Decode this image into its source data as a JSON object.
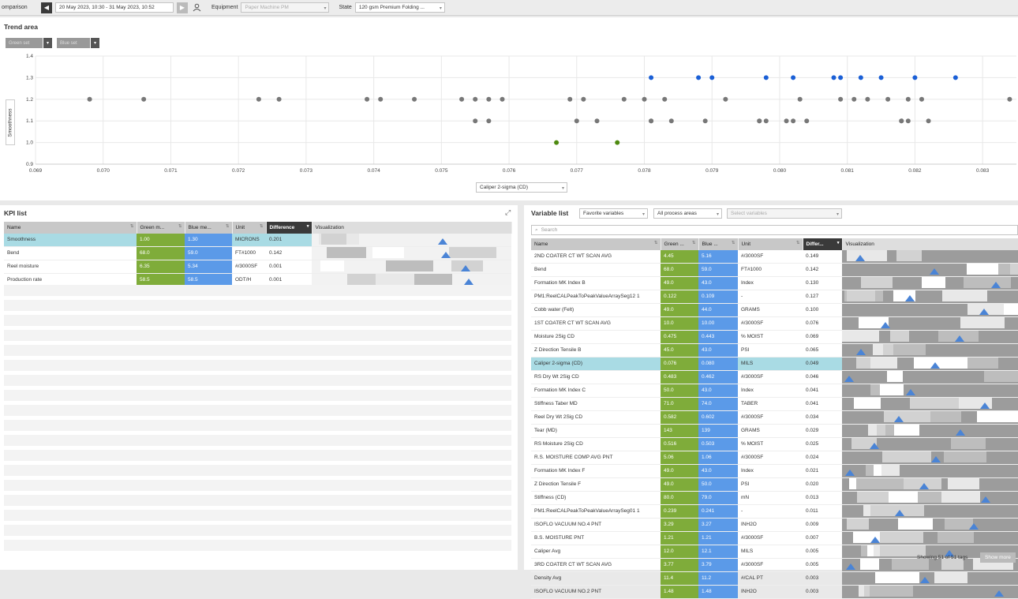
{
  "topbar": {
    "title": "omparison",
    "range": "20 May 2023, 10:30 - 31 May 2023, 10:52",
    "equipment_label": "Equipment",
    "equipment_value": "Paper Machine PM",
    "state_label": "State",
    "state_value": "120 gsm Premium Folding ..."
  },
  "trend": {
    "title": "Trend area",
    "green_set": "Green set",
    "blue_set": "Blue set",
    "y_axis_label": "Smoothness",
    "x_axis_select": "Caliper 2-sigma (CD)"
  },
  "chart_data": {
    "type": "scatter",
    "xlabel": "Caliper 2-sigma (CD)",
    "ylabel": "Smoothness",
    "xlim": [
      0.069,
      0.0835
    ],
    "ylim": [
      0.9,
      1.4
    ],
    "x_ticks": [
      "0.069",
      "0.070",
      "0.071",
      "0.072",
      "0.073",
      "0.074",
      "0.075",
      "0.076",
      "0.077",
      "0.078",
      "0.079",
      "0.080",
      "0.081",
      "0.082",
      "0.083"
    ],
    "y_ticks": [
      "0.9",
      "1.0",
      "1.1",
      "1.2",
      "1.3",
      "1.4"
    ],
    "grid": true,
    "series": [
      {
        "color": "#777777",
        "points": [
          [
            0.0698,
            1.2
          ],
          [
            0.0706,
            1.2
          ],
          [
            0.0723,
            1.2
          ],
          [
            0.0726,
            1.2
          ],
          [
            0.0739,
            1.2
          ],
          [
            0.0741,
            1.2
          ],
          [
            0.0746,
            1.2
          ],
          [
            0.0753,
            1.2
          ],
          [
            0.0755,
            1.2
          ],
          [
            0.0757,
            1.2
          ],
          [
            0.0759,
            1.2
          ],
          [
            0.0769,
            1.2
          ],
          [
            0.0771,
            1.2
          ],
          [
            0.0777,
            1.2
          ],
          [
            0.078,
            1.2
          ],
          [
            0.0783,
            1.2
          ],
          [
            0.0792,
            1.2
          ],
          [
            0.0803,
            1.2
          ],
          [
            0.0809,
            1.2
          ],
          [
            0.0811,
            1.2
          ],
          [
            0.0813,
            1.2
          ],
          [
            0.0816,
            1.2
          ],
          [
            0.0819,
            1.2
          ],
          [
            0.0821,
            1.2
          ],
          [
            0.0834,
            1.2
          ],
          [
            0.0755,
            1.1
          ],
          [
            0.0757,
            1.1
          ],
          [
            0.077,
            1.1
          ],
          [
            0.0773,
            1.1
          ],
          [
            0.0781,
            1.1
          ],
          [
            0.0781,
            1.1
          ],
          [
            0.0784,
            1.1
          ],
          [
            0.0789,
            1.1
          ],
          [
            0.0797,
            1.1
          ],
          [
            0.0797,
            1.1
          ],
          [
            0.0798,
            1.1
          ],
          [
            0.0801,
            1.1
          ],
          [
            0.0802,
            1.1
          ],
          [
            0.0804,
            1.1
          ],
          [
            0.0818,
            1.1
          ],
          [
            0.0818,
            1.1
          ],
          [
            0.0819,
            1.1
          ],
          [
            0.0822,
            1.1
          ]
        ]
      },
      {
        "color": "#1a5fd6",
        "points": [
          [
            0.0781,
            1.3
          ],
          [
            0.0788,
            1.3
          ],
          [
            0.079,
            1.3
          ],
          [
            0.0798,
            1.3
          ],
          [
            0.0802,
            1.3
          ],
          [
            0.0808,
            1.3
          ],
          [
            0.0809,
            1.3
          ],
          [
            0.0812,
            1.3
          ],
          [
            0.0815,
            1.3
          ],
          [
            0.082,
            1.3
          ],
          [
            0.0826,
            1.3
          ]
        ]
      },
      {
        "color": "#4e8a10",
        "points": [
          [
            0.0767,
            1.0
          ],
          [
            0.0776,
            1.0
          ]
        ]
      }
    ]
  },
  "kpi": {
    "title": "KPI list",
    "headers": [
      "Name",
      "Green m...",
      "Blue me...",
      "Unit",
      "Difference",
      "Visualization"
    ],
    "rows": [
      [
        "Smoothness",
        "1.00",
        "1.30",
        "MICRONS",
        "0.201"
      ],
      [
        "Bend",
        "68.0",
        "59.0",
        "FT#1000",
        "0.142"
      ],
      [
        "Reel moisture",
        "6.35",
        "5.34",
        "#/3000SF",
        "0.001"
      ],
      [
        "Production rate",
        "58.5",
        "58.5",
        "ODT/H",
        "0.001"
      ]
    ]
  },
  "vars": {
    "title": "Variable list",
    "favorite": "Favorite variables",
    "areas": "All process areas",
    "select_placeholder": "Select variables",
    "search_placeholder": "Search",
    "headers": [
      "Name",
      "Green ...",
      "Blue ...",
      "Unit",
      "Differ...",
      "Visualization"
    ],
    "rows": [
      [
        "2ND COATER CT WT SCAN AVG",
        "4.45",
        "5.16",
        "#/3000SF",
        "0.149"
      ],
      [
        "Bend",
        "68.0",
        "59.0",
        "FT#1000",
        "0.142"
      ],
      [
        "Formation MK Index B",
        "49.0",
        "43.0",
        "Index",
        "0.130"
      ],
      [
        "PM1:ReelCALPeakToPeakValueArraySeg12 1",
        "0.122",
        "0.109",
        "-",
        "0.127"
      ],
      [
        "Cobb water (Felt)",
        "49.0",
        "44.0",
        "GRAMS",
        "0.100"
      ],
      [
        "1ST COATER CT WT SCAN AVG",
        "10.0",
        "10.00",
        "#/3000SF",
        "0.076"
      ],
      [
        "Moisture 2Sig CD",
        "0.475",
        "0.443",
        "% MOIST",
        "0.069"
      ],
      [
        "Z Direction Tensile B",
        "45.0",
        "43.0",
        "PSI",
        "0.065"
      ],
      [
        "Caliper 2-sigma (CD)",
        "0.076",
        "0.080",
        "MILS",
        "0.049"
      ],
      [
        "RS Dry Wt 2Sig CD",
        "0.483",
        "0.462",
        "#/3000SF",
        "0.046"
      ],
      [
        "Formation MK Index C",
        "50.0",
        "43.0",
        "Index",
        "0.041"
      ],
      [
        "Stiffness Taber MD",
        "71.0",
        "74.0",
        "TABER",
        "0.041"
      ],
      [
        "Reel Dry Wt 2Sig CD",
        "0.582",
        "0.602",
        "#/3000SF",
        "0.034"
      ],
      [
        "Tear (MD)",
        "143",
        "139",
        "GRAMS",
        "0.029"
      ],
      [
        "RS Moisture 2Sig CD",
        "0.516",
        "0.503",
        "% MOIST",
        "0.025"
      ],
      [
        "R.S. MOISTURE COMP AVG PNT",
        "5.06",
        "1.06",
        "#/3000SF",
        "0.024"
      ],
      [
        "Formation MK Index F",
        "49.0",
        "43.0",
        "Index",
        "0.021"
      ],
      [
        "Z Direction Tensile F",
        "49.0",
        "50.0",
        "PSI",
        "0.020"
      ],
      [
        "Stiffness (CD)",
        "80.0",
        "79.0",
        "mN",
        "0.013"
      ],
      [
        "PM1:ReelCALPeakToPeakValueArraySeg01 1",
        "0.239",
        "0.241",
        "-",
        "0.011"
      ],
      [
        "ISOFLO VACUUM NO.4 PNT",
        "3.29",
        "3.27",
        "INH2O",
        "0.009"
      ],
      [
        "B.S. MOISTURE PNT",
        "1.21",
        "1.21",
        "#/3000SF",
        "0.007"
      ],
      [
        "Caliper Avg",
        "12.0",
        "12.1",
        "MILS",
        "0.005"
      ],
      [
        "3RD COATER CT WT SCAN AVG",
        "3.77",
        "3.79",
        "#/3000SF",
        "0.005"
      ],
      [
        "Density Avg",
        "11.4",
        "11.2",
        "#/CAL PT",
        "0.003"
      ],
      [
        "ISOFLO VACUUM NO.2 PNT",
        "1.48",
        "1.48",
        "INH2O",
        "0.003"
      ]
    ],
    "footer": "Showing 51 of 51 tags",
    "show_more": "Show more"
  }
}
